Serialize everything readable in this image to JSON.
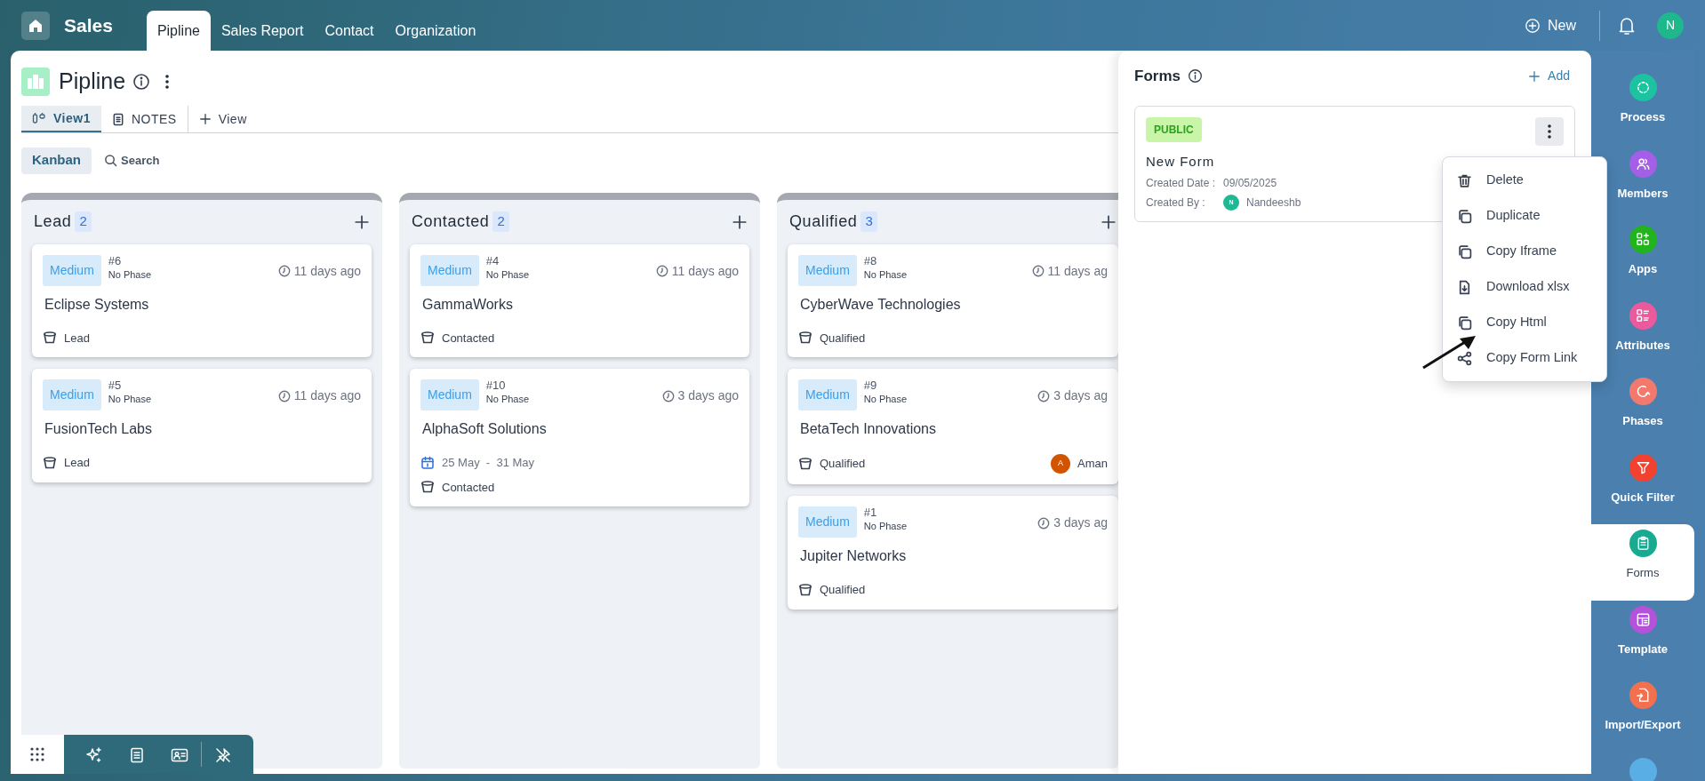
{
  "app": {
    "title": "Sales"
  },
  "nav_tabs": [
    {
      "label": "Pipline",
      "selected": true
    },
    {
      "label": "Sales Report",
      "selected": false
    },
    {
      "label": "Contact",
      "selected": false
    },
    {
      "label": "Organization",
      "selected": false
    }
  ],
  "header_actions": {
    "new_label": "New",
    "user_initial": "N"
  },
  "page": {
    "title": "Pipline"
  },
  "view_tabs": [
    {
      "label": "View1",
      "kind": "view",
      "selected": true
    },
    {
      "label": "NOTES",
      "kind": "notes",
      "selected": false
    },
    {
      "label": "View",
      "kind": "add",
      "selected": false
    }
  ],
  "toolbar": {
    "view_mode": "Kanban",
    "search_label": "Search"
  },
  "columns": [
    {
      "name": "Lead",
      "count": "2",
      "cards": [
        {
          "priority": "Medium",
          "number": "#6",
          "phase": "No Phase",
          "time": "11 days ago",
          "title": "Eclipse Systems",
          "stage": "Lead"
        },
        {
          "priority": "Medium",
          "number": "#5",
          "phase": "No Phase",
          "time": "11 days ago",
          "title": "FusionTech Labs",
          "stage": "Lead"
        }
      ]
    },
    {
      "name": "Contacted",
      "count": "2",
      "cards": [
        {
          "priority": "Medium",
          "number": "#4",
          "phase": "No Phase",
          "time": "11 days ago",
          "title": "GammaWorks",
          "stage": "Contacted"
        },
        {
          "priority": "Medium",
          "number": "#10",
          "phase": "No Phase",
          "time": "3 days ago",
          "title": "AlphaSoft Solutions",
          "dates": "25 May  -  31 May",
          "stage": "Contacted"
        }
      ]
    },
    {
      "name": "Qualified",
      "count": "3",
      "cards": [
        {
          "priority": "Medium",
          "number": "#8",
          "phase": "No Phase",
          "time": "11 days ag",
          "title": "CyberWave Technologies",
          "stage": "Qualified"
        },
        {
          "priority": "Medium",
          "number": "#9",
          "phase": "No Phase",
          "time": "3 days ag",
          "title": "BetaTech Innovations",
          "stage": "Qualified",
          "assignee": {
            "initial": "A",
            "name": "Aman"
          }
        },
        {
          "priority": "Medium",
          "number": "#1",
          "phase": "No Phase",
          "time": "3 days ag",
          "title": "Jupiter Networks",
          "stage": "Qualified"
        }
      ]
    }
  ],
  "forms_panel": {
    "title": "Forms",
    "add_label": "Add",
    "forms": [
      {
        "visibility": "PUBLIC",
        "name": "New Form",
        "created_date_label": "Created Date :",
        "created_date": "09/05/2025",
        "created_by_label": "Created By :",
        "creator_initial": "N",
        "creator": "Nandeeshb"
      }
    ]
  },
  "context_menu": [
    {
      "label": "Delete",
      "kind": "delete"
    },
    {
      "label": "Duplicate",
      "kind": "copy"
    },
    {
      "label": "Copy Iframe",
      "kind": "copy"
    },
    {
      "label": "Download xlsx",
      "kind": "download"
    },
    {
      "label": "Copy Html",
      "kind": "copy"
    },
    {
      "label": "Copy Form Link",
      "kind": "share"
    }
  ],
  "sidebar": [
    {
      "label": "Process",
      "kind": "process",
      "color": "#1cc3a0",
      "selected": false
    },
    {
      "label": "Members",
      "kind": "members",
      "color": "#a55ee8",
      "selected": false
    },
    {
      "label": "Apps",
      "kind": "apps",
      "color": "#22b41c",
      "selected": false
    },
    {
      "label": "Attributes",
      "kind": "attributes",
      "color": "#ea5a9c",
      "selected": false
    },
    {
      "label": "Phases",
      "kind": "phases",
      "color": "#f2796c",
      "selected": false
    },
    {
      "label": "Quick Filter",
      "kind": "filter",
      "color": "#f2412f",
      "selected": false
    },
    {
      "label": "Forms",
      "kind": "forms",
      "color": "#19ab92",
      "selected": true
    },
    {
      "label": "Template",
      "kind": "template",
      "color": "#b452dc",
      "selected": false
    },
    {
      "label": "Import/Export",
      "kind": "import",
      "color": "#f2704e",
      "selected": false
    },
    {
      "kind": "more",
      "color": "#5aaee6",
      "selected": false
    }
  ]
}
